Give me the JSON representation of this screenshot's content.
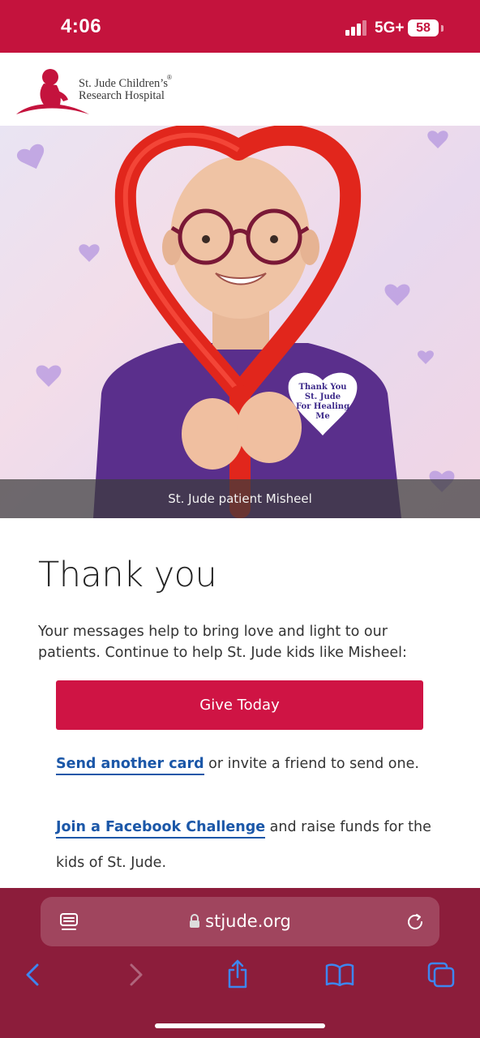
{
  "status_bar": {
    "time": "4:06",
    "network": "5G+",
    "battery": "58"
  },
  "logo": {
    "line1": "St. Jude Children’s",
    "line2": "Research Hospital",
    "registered": "®"
  },
  "hero": {
    "caption": "St. Jude patient Misheel",
    "sign_text": [
      "Thank You",
      "St. Jude",
      "For Healing",
      "Me"
    ]
  },
  "content": {
    "title": "Thank you",
    "body": "Your messages help to bring love and light to our patients. Continue to help St. Jude kids like Misheel:",
    "give_button": "Give Today",
    "send_card_link": "Send another card",
    "send_card_rest": " or invite a friend to send one.",
    "facebook_link": "Join a Facebook Challenge",
    "facebook_rest": " and raise funds for the kids of St. Jude."
  },
  "browser": {
    "url": "stjude.org"
  },
  "colors": {
    "brand_red": "#c4133d",
    "button_red": "#cf1444",
    "link_blue": "#1b57a8",
    "chrome": "#8c1d3b",
    "toolbar_blue": "#3d86f0"
  }
}
